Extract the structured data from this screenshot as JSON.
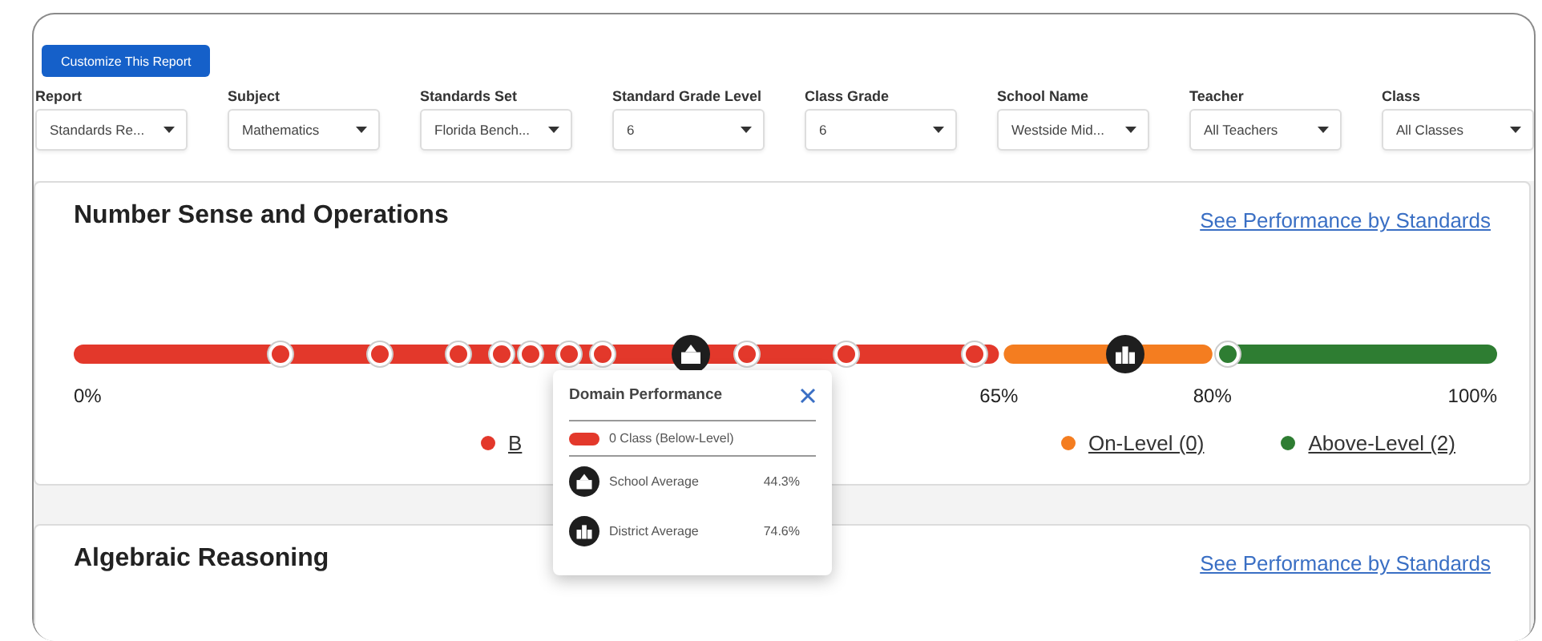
{
  "customize_button": "Customize This Report",
  "filters": [
    {
      "label": "Report",
      "value": "Standards Re..."
    },
    {
      "label": "Subject",
      "value": "Mathematics"
    },
    {
      "label": "Standards Set",
      "value": "Florida Bench..."
    },
    {
      "label": "Standard Grade Level",
      "value": "6"
    },
    {
      "label": "Class Grade",
      "value": "6"
    },
    {
      "label": "School Name",
      "value": "Westside Mid..."
    },
    {
      "label": "Teacher",
      "value": "All Teachers"
    },
    {
      "label": "Class",
      "value": "All Classes"
    }
  ],
  "domains": [
    {
      "title": "Number Sense and Operations",
      "link": "See Performance by Standards",
      "chart_data": {
        "type": "bar",
        "orientation": "horizontal",
        "stacked": true,
        "series": [
          {
            "color": "#e3382b",
            "values": [
              65
            ]
          },
          {
            "color": "#f47d20",
            "values": [
              15
            ]
          },
          {
            "color": "#2e7d32",
            "values": [
              20
            ]
          }
        ],
        "xlim": [
          0,
          100
        ],
        "xticks": [
          {
            "value": 0,
            "label": "0%"
          },
          {
            "value": 65,
            "label": "65%"
          },
          {
            "value": 80,
            "label": "80%"
          },
          {
            "value": 100,
            "label": "100%"
          }
        ]
      },
      "markers": [
        {
          "kind": "class",
          "color": "#e3382b",
          "level": 0.146
        },
        {
          "kind": "class",
          "color": "#e3382b",
          "level": 0.216
        },
        {
          "kind": "class",
          "color": "#e3382b",
          "level": 0.272
        },
        {
          "kind": "class",
          "color": "#e3382b",
          "level": 0.302
        },
        {
          "kind": "class",
          "color": "#e3382b",
          "level": 0.322
        },
        {
          "kind": "class",
          "color": "#e3382b",
          "level": 0.35
        },
        {
          "kind": "class",
          "color": "#e3382b",
          "level": 0.373
        },
        {
          "kind": "school",
          "level": 0.435
        },
        {
          "kind": "class",
          "color": "#e3382b",
          "level": 0.475
        },
        {
          "kind": "class",
          "color": "#e3382b",
          "level": 0.545
        },
        {
          "kind": "class",
          "color": "#e3382b",
          "level": 0.636
        },
        {
          "kind": "district",
          "level": 0.742
        },
        {
          "kind": "class",
          "color": "#2e7d32",
          "level": 0.815
        }
      ],
      "legend": [
        {
          "label": "B",
          "color": "#e3382b"
        },
        {
          "label": "On-Level (0)",
          "color": "#f47d20"
        },
        {
          "label": "Above-Level (2)",
          "color": "#2e7d32"
        }
      ]
    },
    {
      "title": "Algebraic Reasoning",
      "link": "See Performance by Standards"
    }
  ],
  "popup": {
    "title": "Domain Performance",
    "rows": [
      {
        "kind": "class",
        "label": "0 Class (Below-Level)",
        "color": "#e3382b"
      },
      {
        "kind": "school",
        "label": "School Average",
        "value": "44.3%"
      },
      {
        "kind": "district",
        "label": "District Average",
        "value": "74.6%"
      }
    ]
  }
}
